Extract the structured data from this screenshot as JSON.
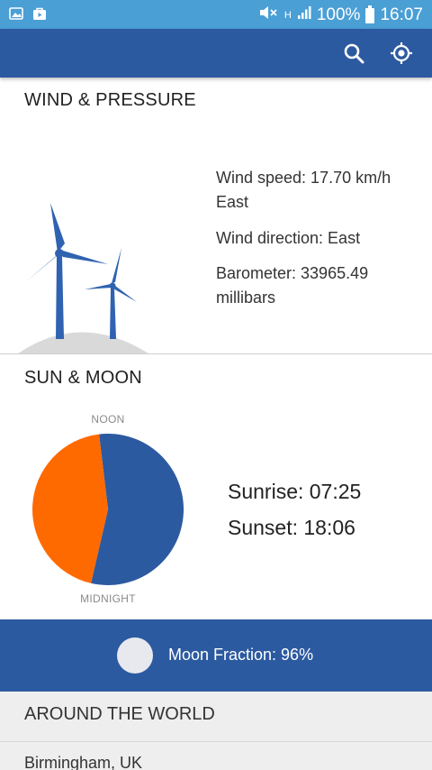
{
  "status_bar": {
    "battery": "100%",
    "time": "16:07",
    "network": "H"
  },
  "colors": {
    "status_bar": "#4a9fd5",
    "primary": "#2c5aa0",
    "day_slice": "#ff6a00",
    "night_slice": "#2c5aa0"
  },
  "wind": {
    "title": "WIND & PRESSURE",
    "speed": "Wind speed: 17.70 km/h East",
    "direction": "Wind direction: East",
    "barometer": "Barometer: 33965.49 millibars"
  },
  "sun": {
    "title": "SUN & MOON",
    "noon_label": "NOON",
    "midnight_label": "MIDNIGHT",
    "sunrise": "Sunrise: 07:25",
    "sunset": "Sunset: 18:06",
    "day_fraction": 0.445
  },
  "moon": {
    "fraction_text": "Moon Fraction: 96%"
  },
  "world": {
    "title": "AROUND THE WORLD",
    "first_city": "Birmingham, UK"
  }
}
